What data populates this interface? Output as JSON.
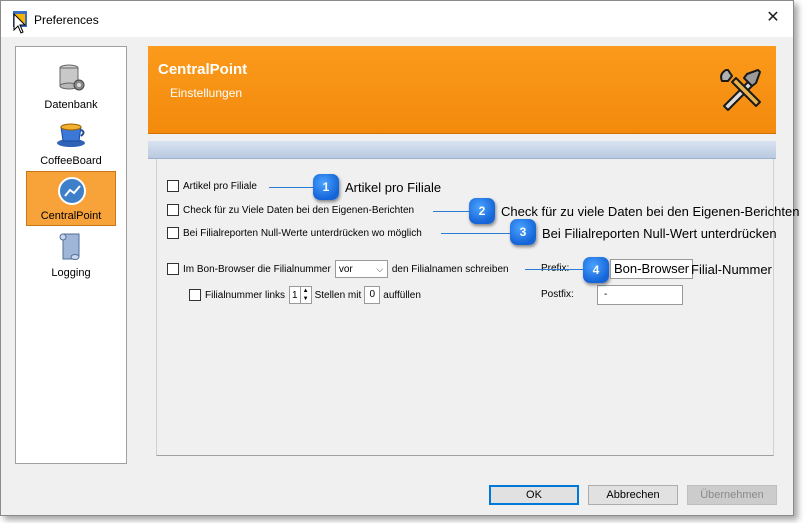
{
  "window": {
    "title": "Preferences"
  },
  "sidebar": {
    "items": [
      {
        "label": "Datenbank",
        "icon": "database-gear-icon"
      },
      {
        "label": "CoffeeBoard",
        "icon": "coffee-cup-icon"
      },
      {
        "label": "CentralPoint",
        "icon": "chart-line-icon",
        "active": true
      },
      {
        "label": "Logging",
        "icon": "scroll-icon"
      }
    ]
  },
  "header": {
    "title": "CentralPoint",
    "subtitle": "Einstellungen",
    "icon": "tools-icon"
  },
  "options": {
    "artikel_label": "Artikel pro Filiale",
    "check_label": "Check für zu Viele Daten bei den Eigenen-Berichten",
    "null_label": "Bei Filialreporten Null-Werte unterdrücken wo möglich",
    "bon_label_before": "Im Bon-Browser die Filialnummer",
    "bon_select_value": "vor",
    "bon_label_after": "den Filialnamen schreiben",
    "filialnr_label": "Filialnummer links",
    "filialnr_spin_value": "1",
    "stellen_label": "Stellen mit",
    "fill_value": "0",
    "auffuellen_label": "auffüllen",
    "prefix_label": "Prefix:",
    "prefix_value": "",
    "postfix_label": "Postfix:",
    "postfix_value": "-"
  },
  "callouts": [
    {
      "number": "1",
      "text": "Artikel pro Filiale"
    },
    {
      "number": "2",
      "text": "Check für zu viele Daten bei den Eigenen-Berichten"
    },
    {
      "number": "3",
      "text": "Bei Filialreporten Null-Wert unterdrücken"
    },
    {
      "number": "4",
      "box_text": "Bon-Browser",
      "text": "Filial-Nummer"
    }
  ],
  "buttons": {
    "ok": "OK",
    "cancel": "Abbrechen",
    "apply": "Übernehmen"
  },
  "colors": {
    "header_orange": "#f7920f",
    "active_item": "#f8a23a",
    "callout_blue": "#1e6fd9"
  }
}
